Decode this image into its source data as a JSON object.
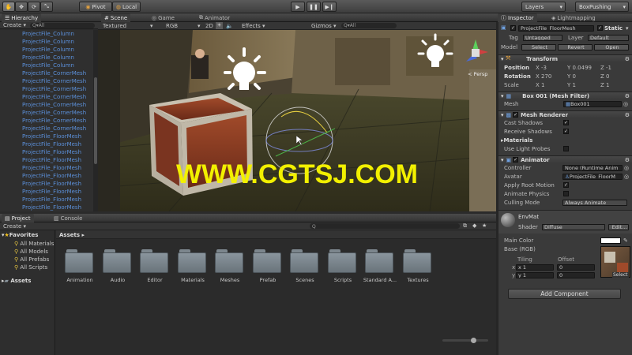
{
  "toolbar": {
    "pivot_label": "Pivot",
    "local_label": "Local",
    "layers_label": "Layers",
    "layout_label": "BoxPushing"
  },
  "hierarchy": {
    "tab": "Hierarchy",
    "create_label": "Create",
    "search_prefix": "Q▾All",
    "items": [
      "ProjectFile_Column",
      "ProjectFile_Column",
      "ProjectFile_Column",
      "ProjectFile_Column",
      "ProjectFile_Column",
      "ProjectFile_CornerMesh",
      "ProjectFile_CornerMesh",
      "ProjectFile_CornerMesh",
      "ProjectFile_CornerMesh",
      "ProjectFile_CornerMesh",
      "ProjectFile_CornerMesh",
      "ProjectFile_CornerMesh",
      "ProjectFile_CornerMesh",
      "ProjectFile_FloorMesh",
      "ProjectFile_FloorMesh",
      "ProjectFile_FloorMesh",
      "ProjectFile_FloorMesh",
      "ProjectFile_FloorMesh",
      "ProjectFile_FloorMesh",
      "ProjectFile_FloorMesh",
      "ProjectFile_FloorMesh",
      "ProjectFile_FloorMesh",
      "ProjectFile_FloorMesh",
      "ProjectFile_FloorMesh"
    ]
  },
  "scene": {
    "tabs": [
      "Scene",
      "Game",
      "Animator"
    ],
    "shading": "Textured",
    "render": "RGB",
    "mode2d": "2D",
    "effects": "Effects",
    "gizmos": "Gizmos",
    "search": "Q▾All",
    "persp_label": "< Persp",
    "watermark": "WWW.CGTSJ.COM"
  },
  "project": {
    "tabs": [
      "Project",
      "Console"
    ],
    "create_label": "Create",
    "favorites_label": "Favorites",
    "favorites": [
      "All Materials",
      "All Models",
      "All Prefabs",
      "All Scripts"
    ],
    "assets_label": "Assets",
    "breadcrumb": "Assets ▸",
    "folders": [
      "Animation",
      "Audio",
      "Editor",
      "Materials",
      "Meshes",
      "Prefab",
      "Scenes",
      "Scripts",
      "Standard A...",
      "Textures"
    ]
  },
  "inspector": {
    "tabs": [
      "Inspector",
      "Lightmapping"
    ],
    "object_name": "ProjectFile_FloorMesh",
    "static_label": "Static",
    "tag_label": "Tag",
    "tag_value": "Untagged",
    "layer_label": "Layer",
    "layer_value": "Default",
    "model_label": "Model",
    "model_buttons": [
      "Select",
      "Revert",
      "Open"
    ],
    "transform": {
      "title": "Transform",
      "position_label": "Position",
      "position": [
        "X -3",
        "Y 0.0499",
        "Z -1"
      ],
      "rotation_label": "Rotation",
      "rotation": [
        "X 270",
        "Y 0",
        "Z 0"
      ],
      "scale_label": "Scale",
      "scale": [
        "X 1",
        "Y 1",
        "Z 1"
      ]
    },
    "mesh_filter": {
      "title": "Box 001 (Mesh Filter)",
      "mesh_label": "Mesh",
      "mesh_value": "Box001"
    },
    "mesh_renderer": {
      "title": "Mesh Renderer",
      "cast_shadows": "Cast Shadows",
      "receive_shadows": "Receive Shadows",
      "materials": "Materials",
      "use_light_probes": "Use Light Probes"
    },
    "animator": {
      "title": "Animator",
      "controller_label": "Controller",
      "controller_value": "None (Runtime Anim",
      "avatar_label": "Avatar",
      "avatar_value": "ProjectFile_FloorM",
      "apply_root_motion": "Apply Root Motion",
      "animate_physics": "Animate Physics",
      "culling_label": "Culling Mode",
      "culling_value": "Always Animate"
    },
    "material": {
      "name": "EnvMat",
      "shader_label": "Shader",
      "shader_value": "Diffuse",
      "edit_label": "Edit...",
      "main_color": "Main Color",
      "base_label": "Base (RGB)",
      "tiling_label": "Tiling",
      "offset_label": "Offset",
      "tiling": [
        "x  1",
        "y  1"
      ],
      "offset": [
        "0",
        "0"
      ],
      "axis_x": "x",
      "axis_y": "y",
      "select_label": "Select"
    },
    "add_component": "Add Component"
  },
  "colors": {
    "accent_blue": "#3a72c8",
    "hierarchy_text": "#5b8fd8",
    "watermark": "#f2f000"
  }
}
